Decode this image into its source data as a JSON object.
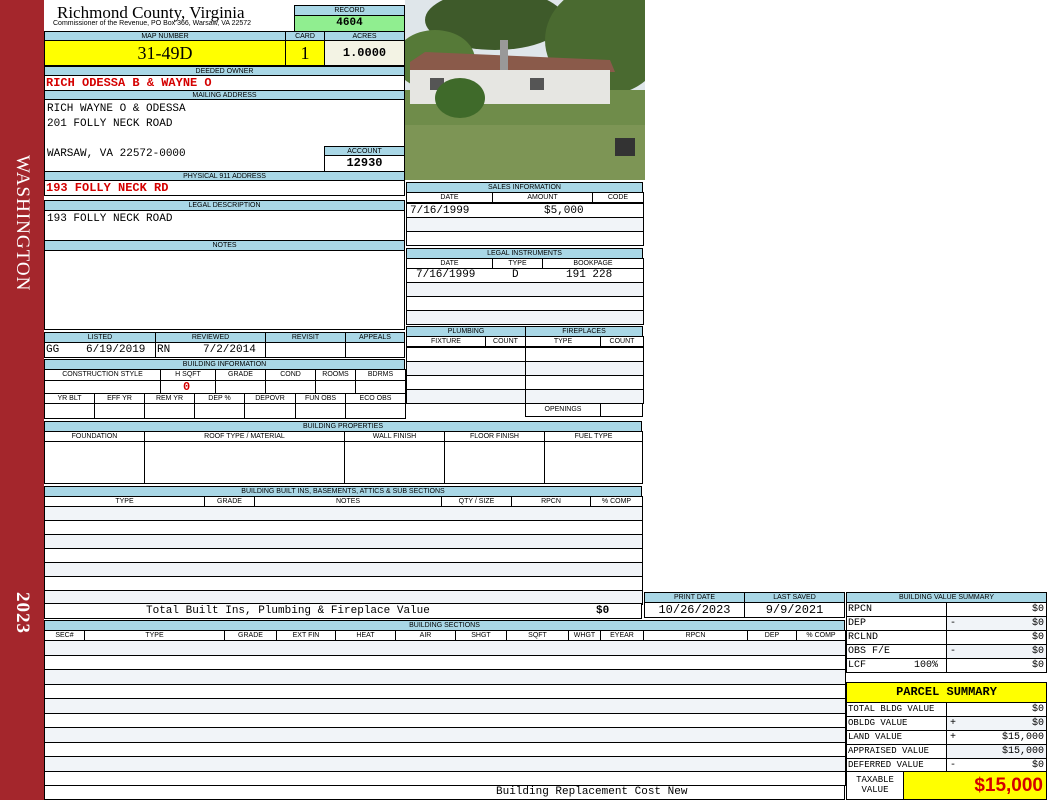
{
  "sidebar": {
    "district": "WASHINGTON",
    "year": "2023"
  },
  "header": {
    "county": "Richmond County, Virginia",
    "office": "Commissioner of the Revenue, PO Box 366, Warsaw, VA 22572",
    "record_label": "RECORD",
    "record": "4604"
  },
  "parcel": {
    "map_label": "MAP NUMBER",
    "map": "31-49D",
    "card_label": "CARD",
    "card": "1",
    "acres_label": "ACRES",
    "acres": "1.0000"
  },
  "owner": {
    "label": "DEEDED OWNER",
    "value": "RICH ODESSA B & WAYNE O"
  },
  "mailing": {
    "label": "MAILING ADDRESS",
    "line1": "RICH WAYNE O & ODESSA",
    "line2": "201 FOLLY NECK ROAD",
    "line3": "WARSAW, VA 22572-0000",
    "account_label": "ACCOUNT",
    "account": "12930"
  },
  "physical": {
    "label": "PHYSICAL 911 ADDRESS",
    "value": "193 FOLLY NECK RD"
  },
  "legal": {
    "label": "LEGAL DESCRIPTION",
    "value": "193 FOLLY NECK ROAD"
  },
  "notes": {
    "label": "NOTES"
  },
  "listing": {
    "listed_label": "LISTED",
    "listed_by": "GG",
    "listed": "6/19/2019",
    "reviewed_label": "REVIEWED",
    "reviewed_by": "RN",
    "reviewed": "7/2/2014",
    "revisit_label": "REVISIT",
    "appeals_label": "APPEALS"
  },
  "building_info": {
    "label": "BUILDING INFORMATION",
    "headers": [
      "CONSTRUCTION STYLE",
      "H SQFT",
      "GRADE",
      "COND",
      "ROOMS",
      "BDRMS"
    ],
    "hsqft": "0",
    "headers2": [
      "YR BLT",
      "EFF YR",
      "REM YR",
      "DEP %",
      "DEPOVR",
      "FUN OBS",
      "ECO OBS"
    ]
  },
  "sales": {
    "label": "SALES INFORMATION",
    "headers": [
      "DATE",
      "AMOUNT",
      "CODE"
    ],
    "rows": [
      {
        "date": "7/16/1999",
        "amount": "$5,000",
        "code": ""
      }
    ]
  },
  "instruments": {
    "label": "LEGAL INSTRUMENTS",
    "headers": [
      "DATE",
      "TYPE",
      "BOOKPAGE"
    ],
    "rows": [
      {
        "date": "7/16/1999",
        "type": "D",
        "bookpage": "191 228"
      }
    ]
  },
  "plumbing": {
    "label": "PLUMBING",
    "headers": [
      "FIXTURE",
      "COUNT"
    ]
  },
  "fireplaces": {
    "label": "FIREPLACES",
    "headers": [
      "TYPE",
      "COUNT"
    ],
    "openings_label": "OPENINGS"
  },
  "properties": {
    "label": "BUILDING PROPERTIES",
    "headers": [
      "FOUNDATION",
      "ROOF TYPE / MATERIAL",
      "WALL FINISH",
      "FLOOR FINISH",
      "FUEL TYPE"
    ]
  },
  "builtins": {
    "label": "BUILDING BUILT INS, BASEMENTS, ATTICS & SUB SECTIONS",
    "headers": [
      "TYPE",
      "GRADE",
      "NOTES",
      "QTY / SIZE",
      "RPCN",
      "% COMP"
    ],
    "total_label": "Total Built Ins, Plumbing & Fireplace Value",
    "total": "$0"
  },
  "dates": {
    "print_label": "PRINT DATE",
    "print": "10/26/2023",
    "saved_label": "LAST SAVED",
    "saved": "9/9/2021"
  },
  "sections": {
    "label": "BUILDING SECTIONS",
    "headers": [
      "SEC#",
      "TYPE",
      "GRADE",
      "EXT FIN",
      "HEAT",
      "AIR",
      "SHGT",
      "SQFT",
      "WHGT",
      "EYEAR",
      "RPCN",
      "DEP",
      "% COMP"
    ],
    "footer": "Building Replacement Cost New"
  },
  "value_summary": {
    "label": "BUILDING VALUE SUMMARY",
    "rows": [
      {
        "label": "RPCN",
        "op": "",
        "value": "$0"
      },
      {
        "label": "DEP",
        "op": "-",
        "value": "$0"
      },
      {
        "label": "RCLND",
        "op": "",
        "value": "$0"
      },
      {
        "label": "OBS F/E",
        "op": "-",
        "value": "$0"
      },
      {
        "label": "LCF",
        "pct": "100%",
        "op": "",
        "value": "$0"
      }
    ]
  },
  "parcel_summary": {
    "title": "PARCEL SUMMARY",
    "rows": [
      {
        "label": "TOTAL BLDG VALUE",
        "op": "",
        "value": "$0"
      },
      {
        "label": "OBLDG VALUE",
        "op": "+",
        "value": "$0"
      },
      {
        "label": "LAND VALUE",
        "op": "+",
        "value": "$15,000"
      },
      {
        "label": "APPRAISED VALUE",
        "op": "",
        "value": "$15,000"
      },
      {
        "label": "DEFERRED VALUE",
        "op": "-",
        "value": "$0"
      }
    ],
    "taxable_label": "TAXABLE VALUE",
    "taxable": "$15,000"
  },
  "colors": {
    "sidebar": "#a4262c",
    "label_bg": "#a9d7e6",
    "highlight": "#ffff00",
    "record_bg": "#90ee90",
    "value_red": "#d40000"
  }
}
